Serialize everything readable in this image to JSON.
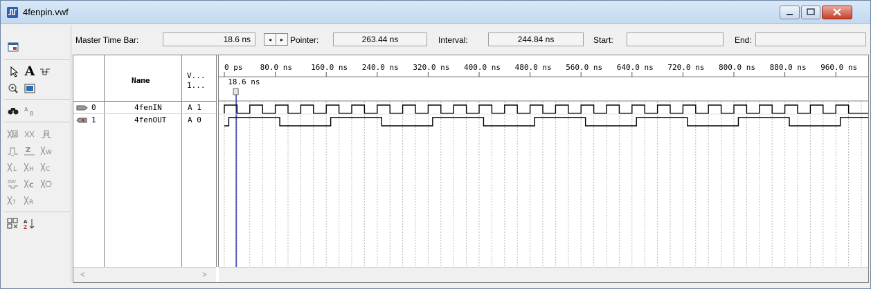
{
  "window": {
    "title": "4fenpin.vwf",
    "accent_color": "#3c64b4"
  },
  "infobar": {
    "master_time_bar_label": "Master Time Bar:",
    "master_time_bar_value": "18.6 ns",
    "pointer_label": "Pointer:",
    "pointer_value": "263.44 ns",
    "interval_label": "Interval:",
    "interval_value": "244.84 ns",
    "start_label": "Start:",
    "start_value": "",
    "end_label": "End:",
    "end_value": ""
  },
  "grid": {
    "col_name_header": "Name",
    "col_value_header_1": "V...",
    "col_value_header_2": "1...",
    "time_marker_label": "18.6 ns",
    "time_ticks": [
      "0 ps",
      "80.0 ns",
      "160.0 ns",
      "240.0 ns",
      "320.0 ns",
      "400.0 ns",
      "480.0 ns",
      "560.0 ns",
      "640.0 ns",
      "720.0 ns",
      "800.0 ns",
      "880.0 ns",
      "960.0 ns"
    ],
    "rows": [
      {
        "index": "0",
        "name": "4fenIN",
        "value": "A 1",
        "type": "input"
      },
      {
        "index": "1",
        "name": "4fenOUT",
        "value": "A 0",
        "type": "output"
      }
    ]
  },
  "waveforms": {
    "time_end_ns": 1000,
    "master_time_ns": 18.6,
    "input_period_ns": 40,
    "input_high_first": true,
    "output_period_ns": 160,
    "output_delay_ns": 7
  },
  "toolbar_icons": [
    "window-icon",
    "pointer-icon",
    "text-icon",
    "waveform-edit-icon",
    "zoom-icon",
    "fullscreen-icon",
    "find-icon",
    "replace-icon",
    "unknown-icon",
    "forcing-icon",
    "weak-icon",
    "low-icon",
    "high-z-icon",
    "weak-low-icon",
    "invert-icon",
    "count-icon",
    "clock-icon",
    "value-icon",
    "random-icon",
    "grid-icon",
    "sort-icon"
  ]
}
